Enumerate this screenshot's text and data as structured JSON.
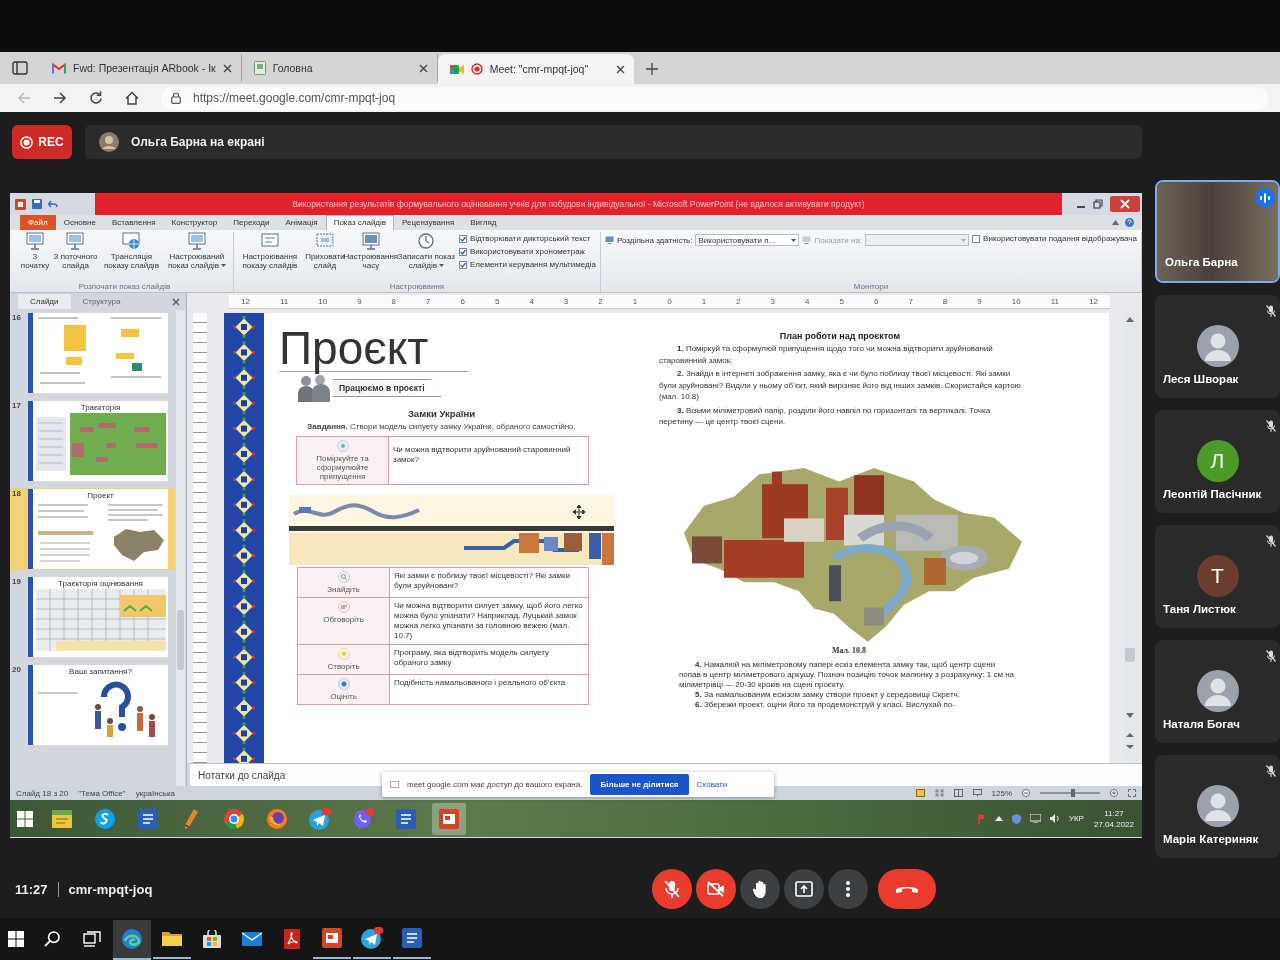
{
  "browser": {
    "tabs": [
      {
        "kind": "mail",
        "title": "Fwd: Презентація ARbook - Ік",
        "selected": false,
        "recording": false
      },
      {
        "kind": "page",
        "title": "Головна",
        "selected": false,
        "recording": false
      },
      {
        "kind": "meet",
        "title": "Meet: \"cmr-mpqt-joq\"",
        "selected": true,
        "recording": true
      }
    ],
    "nav": [
      {
        "kind": "back",
        "disabled": true
      },
      {
        "kind": "forward",
        "disabled": false
      },
      {
        "kind": "reload",
        "disabled": false
      },
      {
        "kind": "home",
        "disabled": false
      }
    ],
    "url": "https://meet.google.com/cmr-mpqt-joq"
  },
  "meet_header": {
    "record_button": "REC",
    "presenter": "Ольга Барна на екрані"
  },
  "powerpoint": {
    "title": "Використання результатів формувального оцінювання учнів для побудови індивідуальної - Microsoft PowerPoint (не вдалося активувати продукт)",
    "ribbon_tabs": [
      {
        "kind": "file",
        "label": "Файл",
        "selected": false
      },
      {
        "kind": "tab",
        "label": "Основне",
        "selected": false
      },
      {
        "kind": "tab",
        "label": "Вставлення",
        "selected": false
      },
      {
        "kind": "tab",
        "label": "Конструктор",
        "selected": false
      },
      {
        "kind": "tab",
        "label": "Переходи",
        "selected": false
      },
      {
        "kind": "tab",
        "label": "Анімація",
        "selected": false
      },
      {
        "kind": "tab",
        "label": "Показ слайдів",
        "selected": true
      },
      {
        "kind": "tab",
        "label": "Рецензування",
        "selected": false
      },
      {
        "kind": "tab",
        "label": "Вигляд",
        "selected": false
      }
    ],
    "ribbon_groups": [
      {
        "label": "Розпочати показ слайдів",
        "items": [
          {
            "kind": "button",
            "label": "З початку",
            "dropdown": false
          },
          {
            "kind": "button",
            "label": "З поточного слайда",
            "dropdown": false
          },
          {
            "kind": "button",
            "label": "Трансляція показу слайдів",
            "dropdown": false
          },
          {
            "kind": "button",
            "label": "Настроюваний показ слайдів",
            "dropdown": true
          }
        ]
      },
      {
        "label": "Настроювання",
        "items": [
          {
            "kind": "button",
            "label": "Настроювання показу слайдів",
            "dropdown": false
          },
          {
            "kind": "button",
            "label": "Приховати слайд",
            "dropdown": false
          },
          {
            "kind": "button",
            "label": "Настроювання часу",
            "dropdown": false
          },
          {
            "kind": "button",
            "label": "Записати показ слайдів",
            "dropdown": true
          },
          {
            "kind": "checks",
            "options": [
              {
                "label": "Відтворювати дикторський текст",
                "checked": true
              },
              {
                "label": "Використовувати хронометраж",
                "checked": true
              },
              {
                "label": "Елементи керування мультимедіа",
                "checked": true
              }
            ]
          }
        ]
      },
      {
        "label": "Монітори",
        "items": [
          {
            "kind": "select",
            "label": "Роздільна здатність:",
            "value": "Використовувати п...",
            "disabled": false
          },
          {
            "kind": "select",
            "label": "Показати на:",
            "disabled": true
          },
          {
            "kind": "checks",
            "options": [
              {
                "label": "Використовувати подання відображувача",
                "checked": false
              }
            ]
          }
        ]
      }
    ],
    "slides_panel": {
      "tabs": [
        {
          "label": "Слайди",
          "selected": true
        },
        {
          "label": "Структура",
          "selected": false
        }
      ],
      "thumbnails": [
        {
          "number": "16",
          "kind": "diagram",
          "selected": false
        },
        {
          "number": "17",
          "title": "Траєкторія",
          "kind": "chart",
          "selected": false
        },
        {
          "number": "18",
          "title": "Проект",
          "kind": "project",
          "selected": true
        },
        {
          "number": "19",
          "title": "Траєкторія оцінювання",
          "kind": "table",
          "selected": false
        },
        {
          "number": "20",
          "title": "Ваші запитання?",
          "kind": "questions",
          "selected": false
        }
      ]
    },
    "ruler": {
      "labels": [
        "12",
        "11",
        "10",
        "9",
        "8",
        "7",
        "6",
        "5",
        "4",
        "3",
        "2",
        "1",
        "0",
        "1",
        "2",
        "3",
        "4",
        "5",
        "6",
        "7",
        "8",
        "9",
        "10",
        "11",
        "12"
      ]
    },
    "slide": {
      "title": "Проєкт",
      "banner": "Працюємо в проєкті",
      "heading": "Замки України",
      "task": "**Завдання.** Створи модель силуету замку України, обраного самостійно.",
      "hypothesis_table": {
        "label": "Поміркуйте та сформулюйте припущення",
        "text": "Чи можна відтворити зруйнований старовинний замок?"
      },
      "steps_table": [
        {
          "label": "Знайдіть",
          "text": "Які замки є поблизу твоєї місцевості? Які замки були зруйновані?"
        },
        {
          "label": "Обговоріть",
          "text": "Чи можна відтворити силует замку, щоб його легко можна було упізнати? Наприклад, Луцький замок можна легко упізнати за головною вежею (мал. 10.7)"
        },
        {
          "label": "Створіть",
          "text": "Програму, яка відтворить модель силуету обраного замку"
        },
        {
          "label": "Оцініть",
          "text": "Подібність намальованого і реального об’єкта"
        }
      ],
      "plan_title": "План роботи над проєктом",
      "plan_items": [
        "**1.** Поміркуй та сформулюй припущення щодо того чи можна відтворити зруйнований старовинний замок.",
        "**2.** Знайди в інтернеті зображення замку, яка є чи було поблизу твоєї місцевості. Які замки були зруйновані? Виділи у ньому об’єкт, який вирізняє його від інших замків. Скористайся картою (мал. 10.8)",
        "**3.** Візьми міліметровий папір, розділи його навпіл по горизонталі та вертикалі. Точка перетину — це центр твоєї сцени."
      ],
      "figure_caption": "Мал. 10.8",
      "plan_items_after": [
        "**4.** Намалюй на міліметровому папері ескіз елемента замку так, щоб центр сцени попав в центр міліметрового аркушу. Познач позицію точок малюнку з розрахунку: 1 см на міліметрівці — 20-30 кроків на сцені проєкту.",
        "**5.** За намальованим ескізом замку створи проект у середовищі Скретч.",
        "**6.** Збережи проект, оціни його та продемонструй у класі. Вислухай по-"
      ]
    },
    "notes": {
      "placeholder": "Нотатки до слайда"
    },
    "status_bar": {
      "slide": "Слайд 18 з 20",
      "theme": "\"Тема Office\"",
      "language": "українська",
      "zoom": "125%",
      "zoom_slider": {
        "level": 0.55
      }
    },
    "share_notice": {
      "message": "meet.google.com має доступ до вашого екрана.",
      "stop_button": "Більше не ділитися",
      "hide_link": "Сховати"
    },
    "taskbar": {
      "apps": [
        {
          "kind": "start",
          "selected": false
        },
        {
          "kind": "notes",
          "selected": false
        },
        {
          "kind": "chat",
          "selected": false
        },
        {
          "kind": "document",
          "selected": false
        },
        {
          "kind": "pencil",
          "selected": false
        },
        {
          "kind": "wheel",
          "selected": false
        },
        {
          "kind": "fox",
          "selected": false
        },
        {
          "kind": "messenger",
          "selected": false
        },
        {
          "kind": "phone",
          "selected": false
        },
        {
          "kind": "document",
          "selected": false
        },
        {
          "kind": "presentation",
          "selected": true
        }
      ],
      "language": "УКР",
      "time": "11:27",
      "date": "27.04.2022"
    }
  },
  "participants": [
    {
      "name": "Ольга Барна",
      "kind": "video",
      "speaking": true,
      "muted": false
    },
    {
      "name": "Леся Шворак",
      "kind": "photo",
      "speaking": false,
      "muted": true
    },
    {
      "name": "Леонтій Пасічник",
      "kind": "letter",
      "initial": "Л",
      "color": "#4e9a28",
      "speaking": false,
      "muted": true
    },
    {
      "name": "Таня Листюк",
      "kind": "letter",
      "initial": "Т",
      "color": "#6b3d2e",
      "speaking": false,
      "muted": true
    },
    {
      "name": "Наталя Богач",
      "kind": "photo",
      "speaking": false,
      "muted": true
    },
    {
      "name": "Марія Катериняк",
      "kind": "photo",
      "speaking": false,
      "muted": true
    }
  ],
  "meeting_bar": {
    "time": "11:27",
    "code": "cmr-mpqt-joq",
    "controls": [
      {
        "kind": "microphone",
        "muted": true
      },
      {
        "kind": "camera",
        "muted": true
      },
      {
        "kind": "raise-hand"
      },
      {
        "kind": "present"
      },
      {
        "kind": "more"
      },
      {
        "kind": "end-call"
      }
    ]
  },
  "windows_taskbar": {
    "apps": [
      {
        "kind": "start",
        "running": false,
        "selected": false
      },
      {
        "kind": "search",
        "running": false,
        "selected": false
      },
      {
        "kind": "task-view",
        "running": false,
        "selected": false
      },
      {
        "kind": "browser",
        "running": true,
        "selected": true
      },
      {
        "kind": "folder",
        "running": true,
        "selected": false
      },
      {
        "kind": "store",
        "running": false,
        "selected": false
      },
      {
        "kind": "mail",
        "running": false,
        "selected": false
      },
      {
        "kind": "pdf",
        "running": false,
        "selected": false
      },
      {
        "kind": "presentation",
        "running": true,
        "selected": false
      },
      {
        "kind": "messenger",
        "running": true,
        "selected": false
      },
      {
        "kind": "document",
        "running": true,
        "selected": false
      }
    ]
  }
}
